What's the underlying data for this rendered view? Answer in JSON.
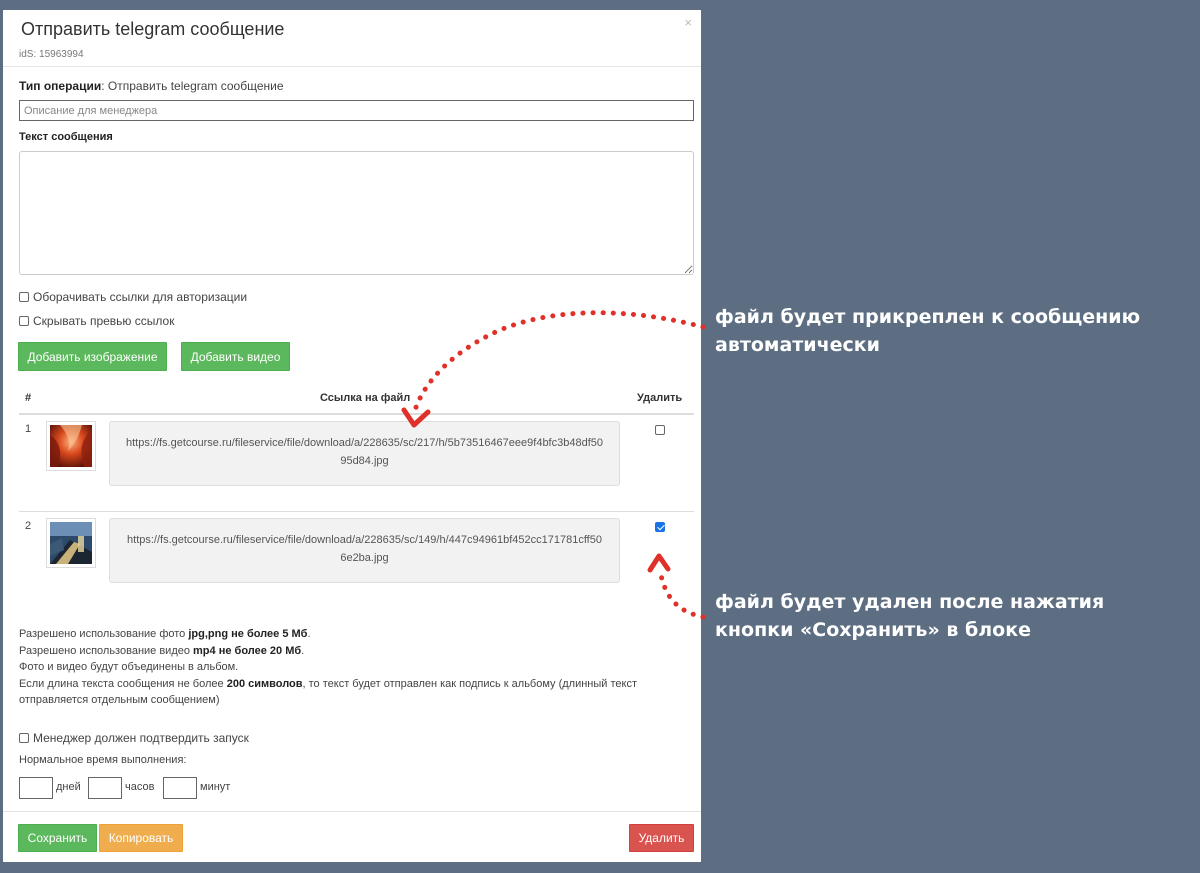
{
  "modal": {
    "title": "Отправить telegram сообщение",
    "ids": "idS: 15963994",
    "close_glyph": "×"
  },
  "operation": {
    "label": "Тип операции",
    "value": ": Отправить telegram сообщение"
  },
  "description_field": {
    "placeholder": "Описание для менеджера",
    "value": ""
  },
  "message": {
    "label": "Текст сообщения",
    "value": ""
  },
  "options": [
    {
      "label": "Оборачивать ссылки для авторизации",
      "checked": false
    },
    {
      "label": "Скрывать превью ссылок",
      "checked": false
    }
  ],
  "buttons": {
    "add_image": "Добавить изображение",
    "add_video": "Добавить видео",
    "save": "Сохранить",
    "copy": "Копировать",
    "delete": "Удалить"
  },
  "files_table": {
    "headers": {
      "num": "#",
      "link": "Ссылка на файл",
      "delete": "Удалить"
    },
    "rows": [
      {
        "num": "1",
        "thumb": "red-canyon-image",
        "url": "https://fs.getcourse.ru/fileservice/file/download/a/228635/sc/217/h/5b73516467eee9f4bfc3b48df5095d84.jpg",
        "delete_checked": false
      },
      {
        "num": "2",
        "thumb": "city-road-image",
        "url": "https://fs.getcourse.ru/fileservice/file/download/a/228635/sc/149/h/447c94961bf452cc171781cff506e2ba.jpg",
        "delete_checked": true
      }
    ]
  },
  "info": {
    "line1_pre": "Разрешено использование фото ",
    "line1_bold": "jpg,png не более 5 Мб",
    "line1_post": ".",
    "line2_pre": "Разрешено использование видео ",
    "line2_bold": "mp4 не более 20 Мб",
    "line2_post": ".",
    "line3": "Фото и видео будут объединены в альбом.",
    "line4_pre": "Если длина текста сообщения не более ",
    "line4_bold": "200 символов",
    "line4_post": ", то текст будет отправлен как подпись к альбому (длинный текст отправляется отдельным сообщением)"
  },
  "confirm": {
    "label": "Менеджер должен подтвердить запуск",
    "checked": false
  },
  "timing": {
    "label": "Нормальное время выполнения:",
    "days_label": "дней",
    "hours_label": "часов",
    "minutes_label": "минут"
  },
  "annotations": {
    "top_line1": "файл будет прикреплен к сообщению",
    "top_line2": "автоматически",
    "bottom_line1": "файл будет удален после нажатия",
    "bottom_line2": "кнопки «Сохранить» в блоке",
    "arrow_color": "#e0302a"
  },
  "colors": {
    "background": "#5d6e83",
    "green": "#5cb85c",
    "orange": "#f0ad4e",
    "red": "#d9534f",
    "checkbox_blue": "#1a73e8"
  }
}
